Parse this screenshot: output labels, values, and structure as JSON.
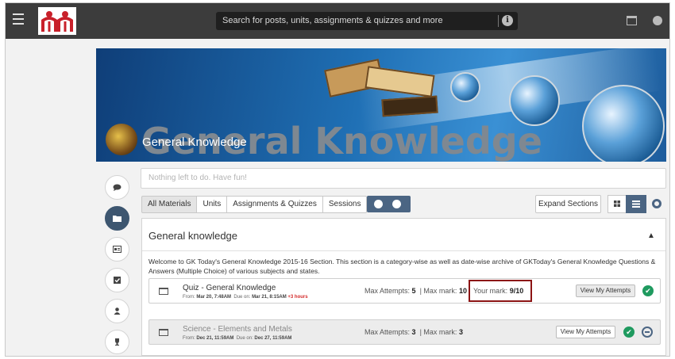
{
  "header": {
    "search_placeholder": "Search for posts, units, assignments & quizzes and more"
  },
  "banner": {
    "title": "General Knowledge",
    "big_word": "General Knowledge"
  },
  "notice": "Nothing left to do. Have fun!",
  "tabs": [
    "All Materials",
    "Units",
    "Assignments & Quizzes",
    "Sessions"
  ],
  "controls": {
    "expand_label": "Expand Sections"
  },
  "section": {
    "title": "General knowledge",
    "description": "Welcome to GK Today's General Knowledge 2015-16 Section. This section is a category-wise as well as date-wise archive of GKToday's General Knowledge Questions & Answers (Multiple Choice) of various subjects and states.",
    "items": [
      {
        "title": "Quiz - General Knowledge",
        "from_label": "From:",
        "from": "Mar 20, 7:48AM",
        "due_label": "Due on:",
        "due": "Mar 21, 8:15AM",
        "late": "+3 hours",
        "attempts_label": "Max Attempts:",
        "attempts": "5",
        "mark_label": "Max mark:",
        "mark": "10",
        "your_mark_label": "Your mark:",
        "your_mark": "9/10",
        "button": "View My Attempts"
      },
      {
        "title": "Science - Elements and Metals",
        "from_label": "From:",
        "from": "Dec 21, 11:59AM",
        "due_label": "Due on:",
        "due": "Dec 27, 11:59AM",
        "attempts_label": "Max Attempts:",
        "attempts": "3",
        "mark_label": "Max mark:",
        "mark": "3",
        "button": "View My Attempts"
      }
    ]
  },
  "icons": {
    "menu": "hamburger-icon",
    "info": "info-icon",
    "calendar": "calendar-icon",
    "globe": "globe-icon",
    "sidebar": [
      "comment-icon",
      "folder-icon",
      "id-card-icon",
      "check-square-icon",
      "user-icon",
      "trophy-icon"
    ]
  },
  "colors": {
    "topbar": "#3c3c3c",
    "accent": "#4b6583",
    "success": "#1f9a5f",
    "late": "#d42a2a",
    "highlight_box": "#8c1414"
  }
}
